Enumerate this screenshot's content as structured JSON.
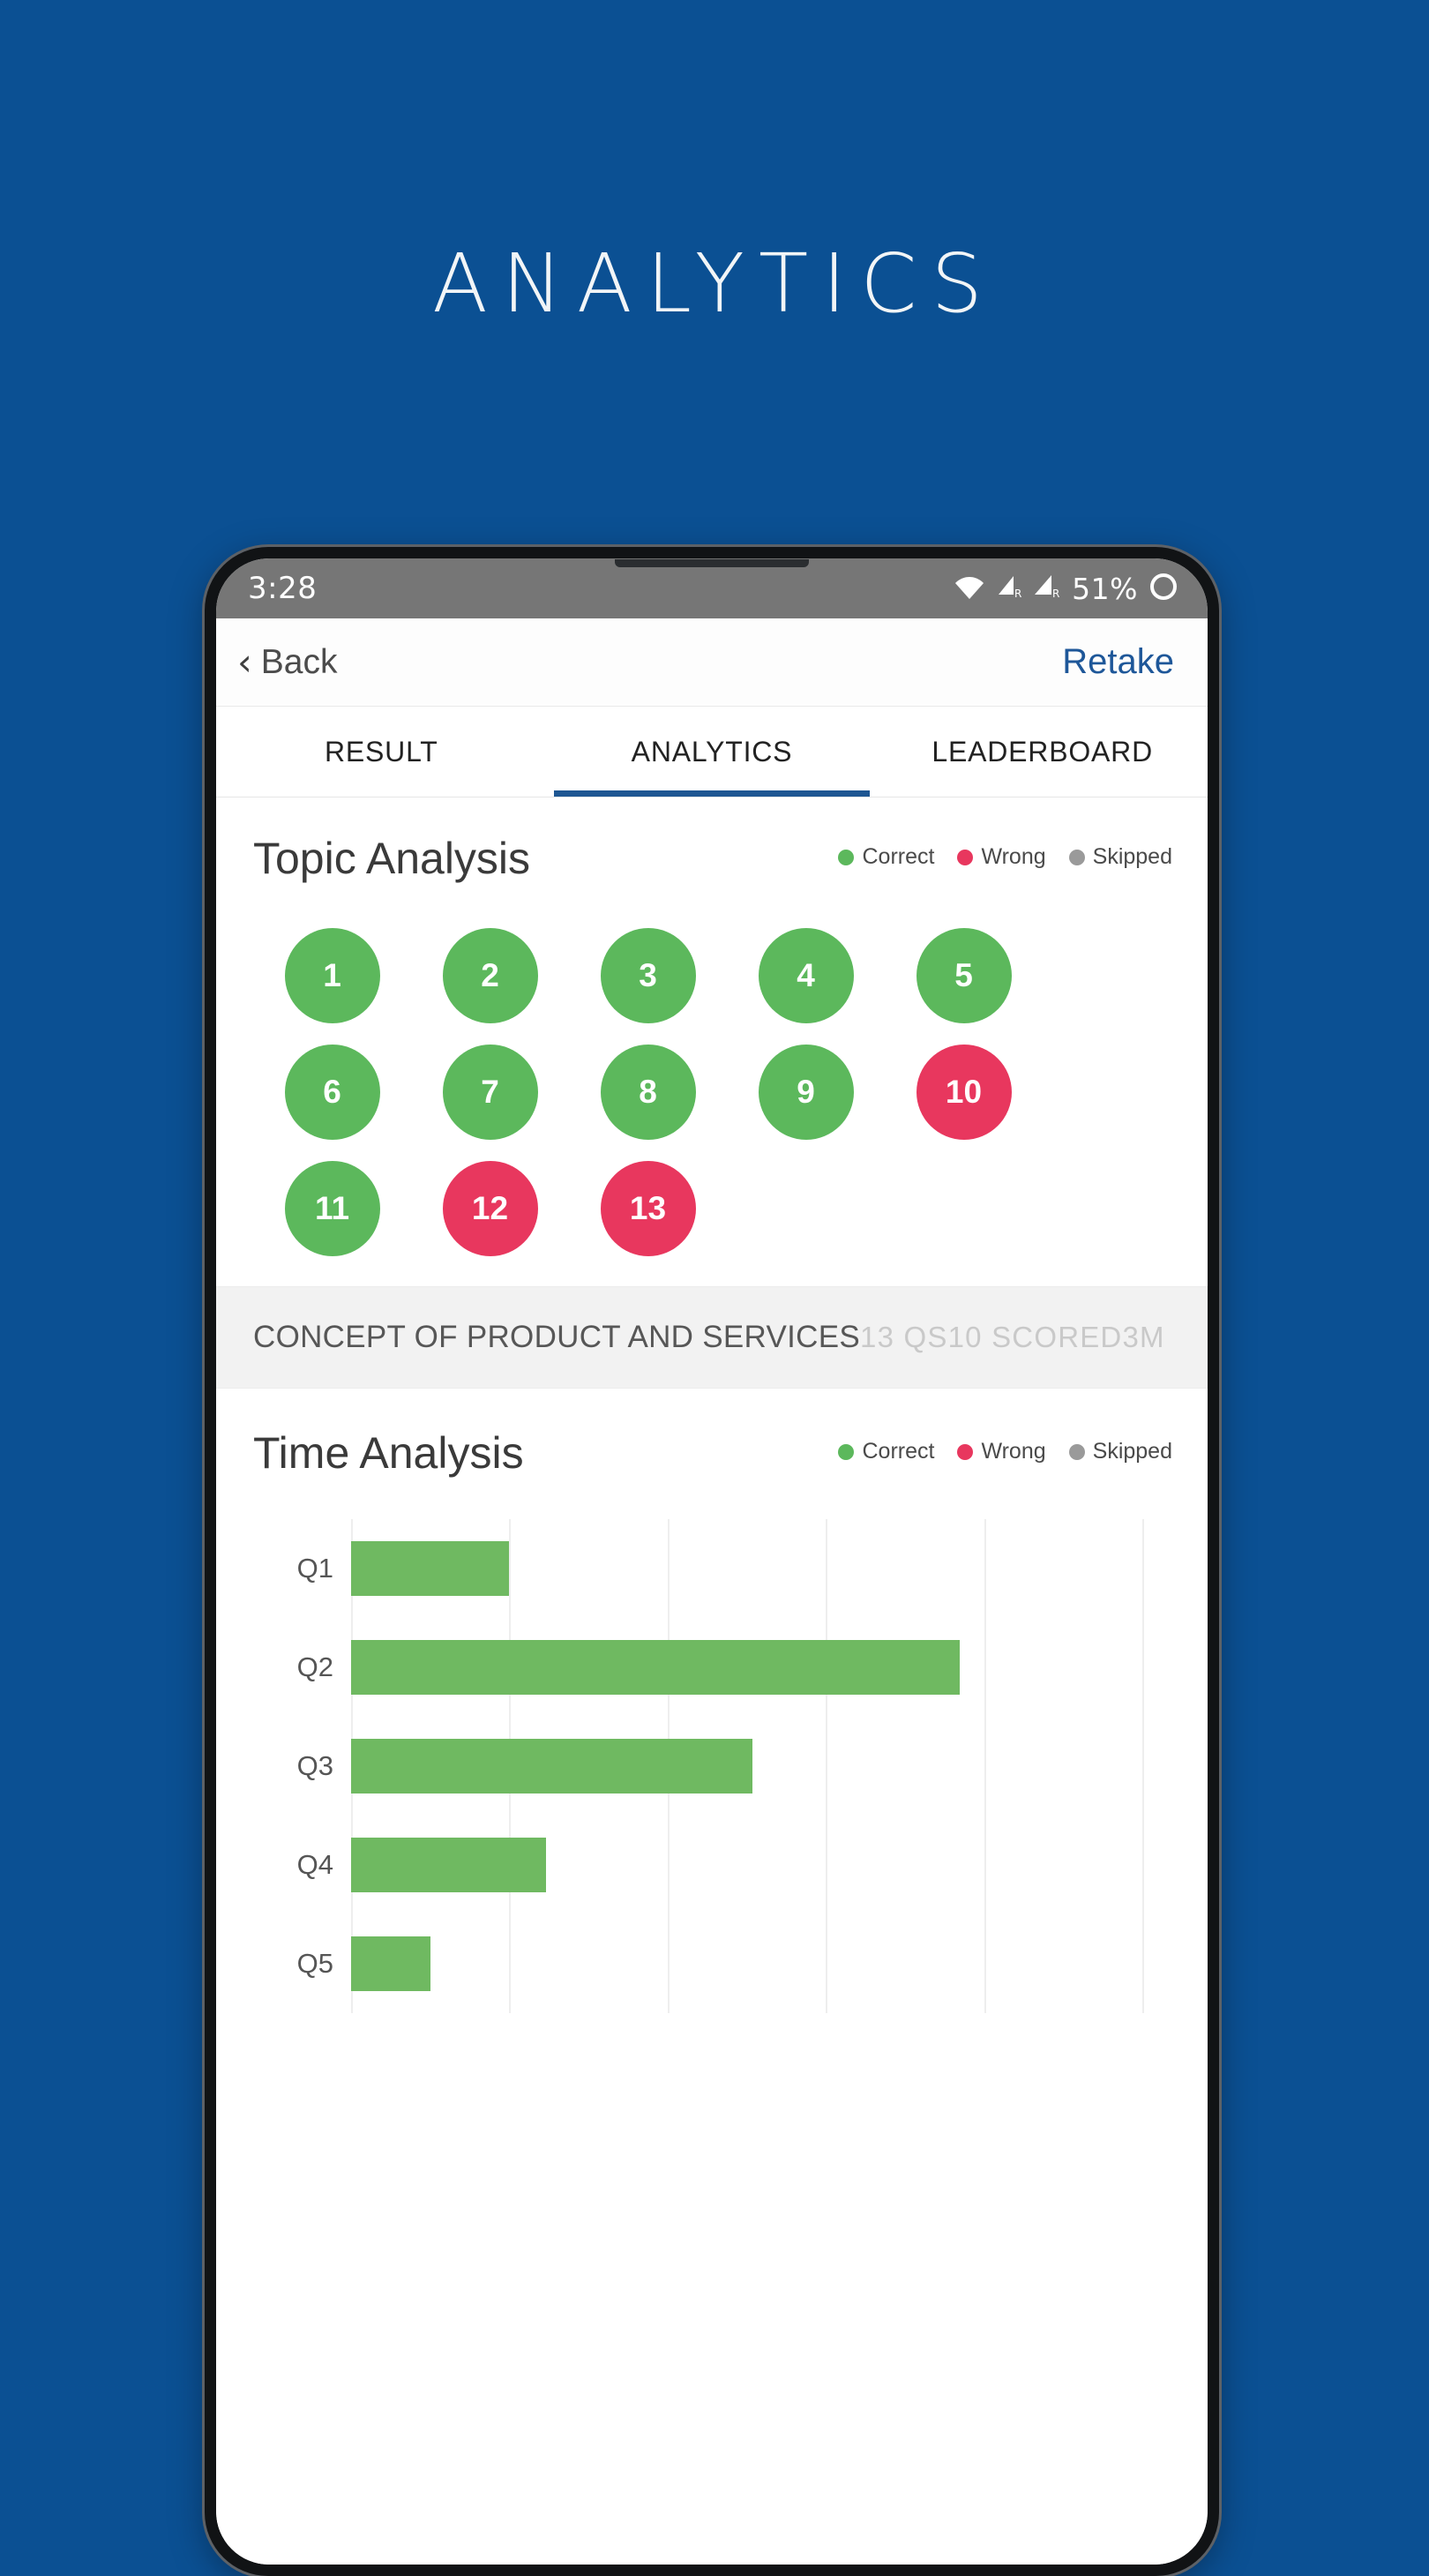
{
  "page": {
    "title": "ANALYTICS",
    "background_color": "#0b5093"
  },
  "status_bar": {
    "time": "3:28",
    "battery_percent": "51%",
    "icons": [
      "wifi-icon",
      "signal-roaming-icon-1",
      "signal-roaming-icon-2",
      "battery-icon"
    ],
    "roaming_label": "R"
  },
  "nav_bar": {
    "back_label": "Back",
    "back_chevron": "‹",
    "retake_label": "Retake",
    "retake_color": "#1e5799"
  },
  "tabs": [
    {
      "label": "RESULT",
      "active": false
    },
    {
      "label": "ANALYTICS",
      "active": true
    },
    {
      "label": "LEADERBOARD",
      "active": false
    }
  ],
  "legend": [
    {
      "label": "Correct",
      "color": "#5cb85c"
    },
    {
      "label": "Wrong",
      "color": "#e8375e"
    },
    {
      "label": "Skipped",
      "color": "#9a9a9a"
    }
  ],
  "topic_analysis": {
    "title": "Topic Analysis",
    "questions": [
      {
        "number": "1",
        "status": "correct"
      },
      {
        "number": "2",
        "status": "correct"
      },
      {
        "number": "3",
        "status": "correct"
      },
      {
        "number": "4",
        "status": "correct"
      },
      {
        "number": "5",
        "status": "correct"
      },
      {
        "number": "6",
        "status": "correct"
      },
      {
        "number": "7",
        "status": "correct"
      },
      {
        "number": "8",
        "status": "correct"
      },
      {
        "number": "9",
        "status": "correct"
      },
      {
        "number": "10",
        "status": "wrong"
      },
      {
        "number": "11",
        "status": "correct"
      },
      {
        "number": "12",
        "status": "wrong"
      },
      {
        "number": "13",
        "status": "wrong"
      }
    ],
    "topic_band": {
      "name": "CONCEPT OF PRODUCT AND SERVICES",
      "question_count": "13 QS",
      "scored": "10 SCORED",
      "time": "3M"
    }
  },
  "time_analysis": {
    "title": "Time Analysis"
  },
  "chart_data": {
    "type": "bar",
    "orientation": "horizontal",
    "title": "Time Analysis",
    "categories": [
      "Q1",
      "Q2",
      "Q3",
      "Q4",
      "Q5"
    ],
    "values": [
      26,
      100,
      66,
      32,
      13
    ],
    "colors": [
      "#6fb961",
      "#6fb961",
      "#6fb961",
      "#6fb961",
      "#6fb961"
    ],
    "series": [
      {
        "name": "Correct",
        "color": "#6fb961",
        "values": [
          26,
          100,
          66,
          32,
          13
        ]
      }
    ],
    "xlabel": "",
    "ylabel": "",
    "xlim": [
      0,
      130
    ],
    "gridlines": [
      0,
      26,
      52,
      78,
      104,
      130
    ],
    "grid": true,
    "legend_position": "top-right"
  }
}
